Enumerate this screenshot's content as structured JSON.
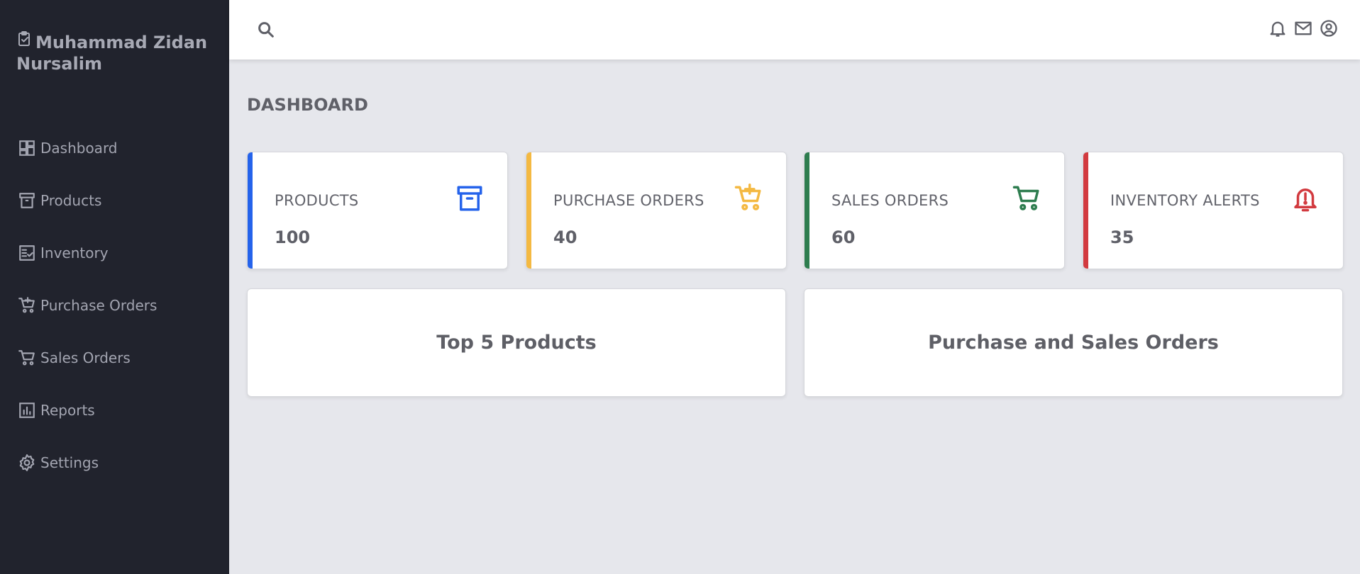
{
  "brand": {
    "name": "Muhammad Zidan Nursalim",
    "icon": "clipboard-check-icon"
  },
  "sidebar": {
    "items": [
      {
        "label": "Dashboard",
        "icon": "dashboard-icon"
      },
      {
        "label": "Products",
        "icon": "archive-icon"
      },
      {
        "label": "Inventory",
        "icon": "checklist-icon"
      },
      {
        "label": "Purchase Orders",
        "icon": "cart-plus-icon"
      },
      {
        "label": "Sales Orders",
        "icon": "cart-icon"
      },
      {
        "label": "Reports",
        "icon": "bar-chart-icon"
      },
      {
        "label": "Settings",
        "icon": "gear-icon"
      }
    ]
  },
  "topbar": {
    "search_icon": "search-icon",
    "right_icons": [
      "bell-icon",
      "mail-icon",
      "account-circle-icon"
    ]
  },
  "main": {
    "title": "DASHBOARD",
    "stats": [
      {
        "label": "PRODUCTS",
        "value": "100",
        "icon": "archive-icon",
        "color": "#2563eb"
      },
      {
        "label": "PURCHASE ORDERS",
        "value": "40",
        "icon": "cart-plus-icon",
        "color": "#f4b942"
      },
      {
        "label": "SALES ORDERS",
        "value": "60",
        "icon": "cart-icon",
        "color": "#2e7d4f"
      },
      {
        "label": "INVENTORY ALERTS",
        "value": "35",
        "icon": "alert-bell-icon",
        "color": "#d23a3f"
      }
    ],
    "panels": [
      {
        "title": "Top 5 Products"
      },
      {
        "title": "Purchase and Sales Orders"
      }
    ]
  },
  "colors": {
    "sidebar_bg": "#21232d",
    "page_bg": "#e6e7ec",
    "sidebar_text": "#a3a5b1"
  }
}
